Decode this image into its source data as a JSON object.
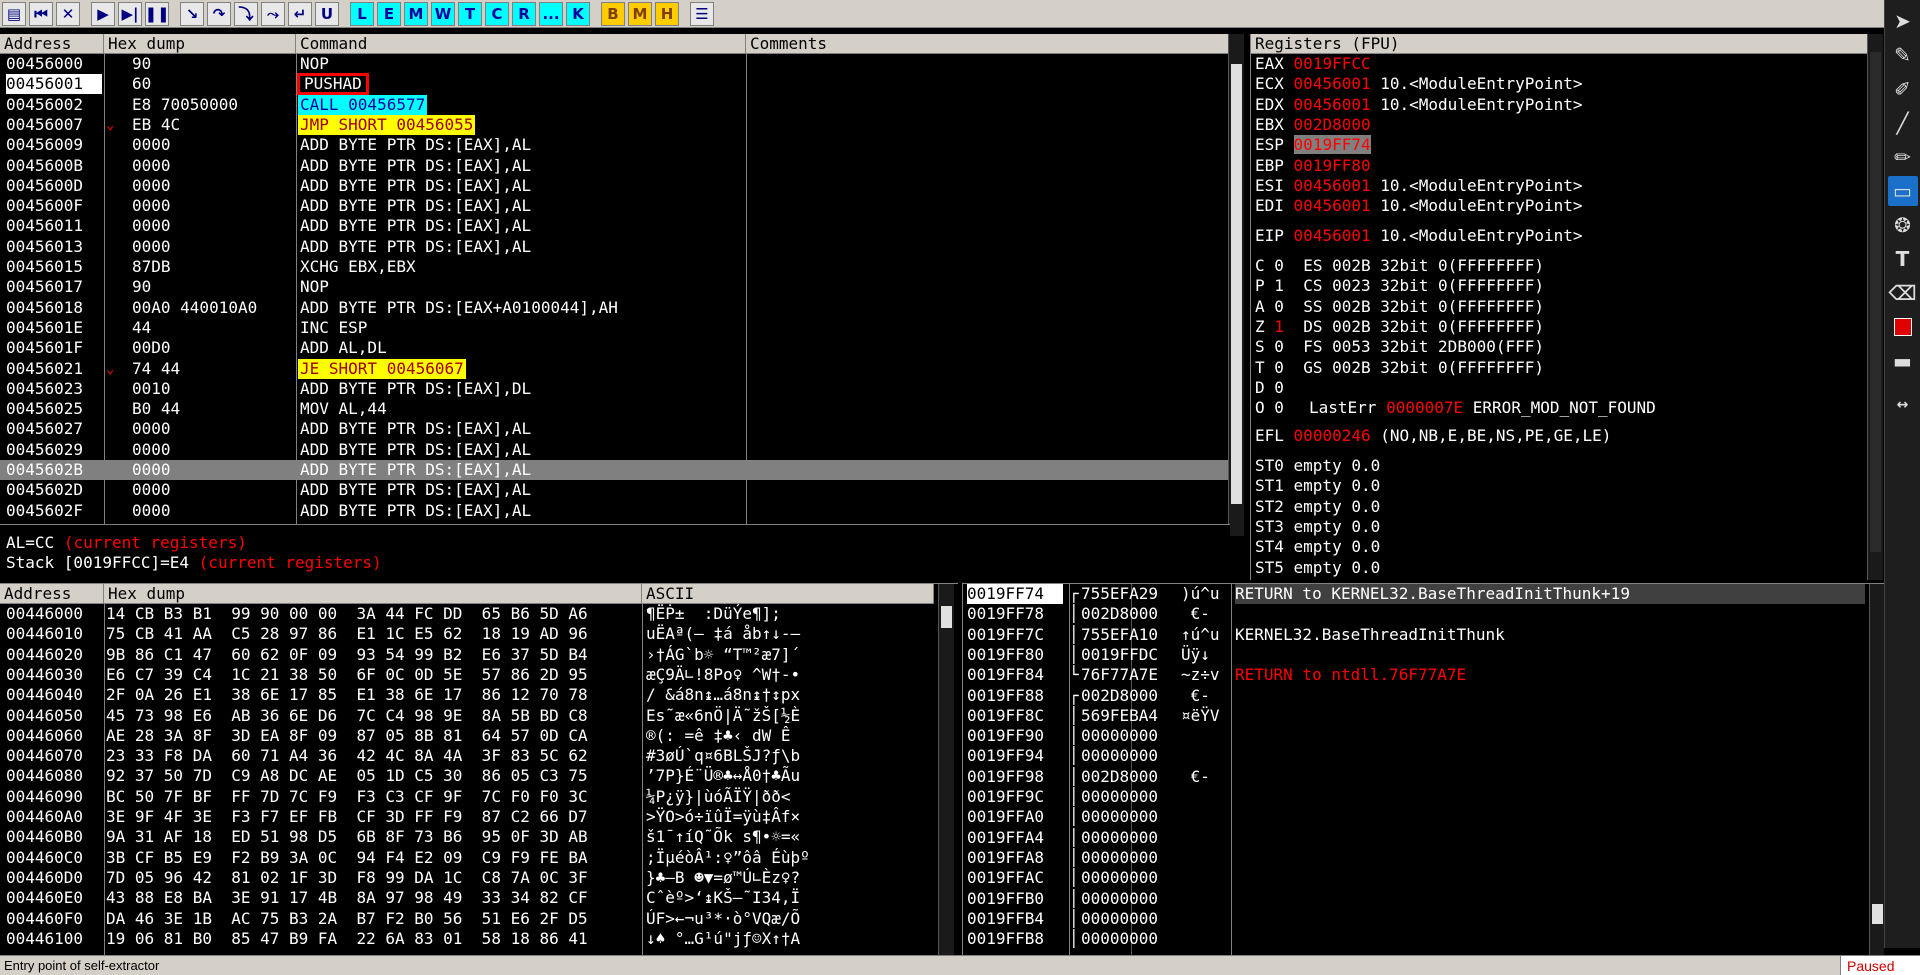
{
  "toolbar": {
    "buttons": [
      "open",
      "rewind",
      "close",
      "run",
      "run-thread",
      "pause",
      "step-into",
      "step-over",
      "trace-into",
      "trace-over",
      "execute-till-return",
      "user-code",
      "L",
      "E",
      "M",
      "W",
      "T",
      "C",
      "R",
      "...",
      "K",
      "B",
      "M",
      "H",
      "list"
    ]
  },
  "disasm": {
    "headers": [
      "Address",
      "Hex dump",
      "Command",
      "Comments"
    ],
    "rows": [
      {
        "addr": "00456000",
        "hex": "90",
        "cmd": "NOP",
        "style": "normal",
        "jump": ""
      },
      {
        "addr": "00456001",
        "hex": "60",
        "cmd": "PUSHAD",
        "style": "eip",
        "jump": ""
      },
      {
        "addr": "00456002",
        "hex": "E8 70050000",
        "cmd": "CALL 00456577",
        "style": "call",
        "jump": ""
      },
      {
        "addr": "00456007",
        "hex": "EB 4C",
        "cmd": "JMP SHORT 00456055",
        "style": "jmp",
        "jump": "⌄"
      },
      {
        "addr": "00456009",
        "hex": "0000",
        "cmd": "ADD BYTE PTR DS:[EAX],AL",
        "style": "normal",
        "jump": ""
      },
      {
        "addr": "0045600B",
        "hex": "0000",
        "cmd": "ADD BYTE PTR DS:[EAX],AL",
        "style": "normal",
        "jump": ""
      },
      {
        "addr": "0045600D",
        "hex": "0000",
        "cmd": "ADD BYTE PTR DS:[EAX],AL",
        "style": "normal",
        "jump": ""
      },
      {
        "addr": "0045600F",
        "hex": "0000",
        "cmd": "ADD BYTE PTR DS:[EAX],AL",
        "style": "normal",
        "jump": ""
      },
      {
        "addr": "00456011",
        "hex": "0000",
        "cmd": "ADD BYTE PTR DS:[EAX],AL",
        "style": "normal",
        "jump": ""
      },
      {
        "addr": "00456013",
        "hex": "0000",
        "cmd": "ADD BYTE PTR DS:[EAX],AL",
        "style": "normal",
        "jump": ""
      },
      {
        "addr": "00456015",
        "hex": "87DB",
        "cmd": "XCHG EBX,EBX",
        "style": "normal",
        "jump": ""
      },
      {
        "addr": "00456017",
        "hex": "90",
        "cmd": "NOP",
        "style": "normal",
        "jump": ""
      },
      {
        "addr": "00456018",
        "hex": "00A0 440010A0",
        "cmd": "ADD BYTE PTR DS:[EAX+A0100044],AH",
        "style": "normal",
        "jump": ""
      },
      {
        "addr": "0045601E",
        "hex": "44",
        "cmd": "INC ESP",
        "style": "normal",
        "jump": ""
      },
      {
        "addr": "0045601F",
        "hex": "00D0",
        "cmd": "ADD AL,DL",
        "style": "normal",
        "jump": ""
      },
      {
        "addr": "00456021",
        "hex": "74 44",
        "cmd": "JE SHORT 00456067",
        "style": "jmp",
        "jump": "⌄"
      },
      {
        "addr": "00456023",
        "hex": "0010",
        "cmd": "ADD BYTE PTR DS:[EAX],DL",
        "style": "normal",
        "jump": ""
      },
      {
        "addr": "00456025",
        "hex": "B0 44",
        "cmd": "MOV AL,44",
        "style": "normal",
        "jump": ""
      },
      {
        "addr": "00456027",
        "hex": "0000",
        "cmd": "ADD BYTE PTR DS:[EAX],AL",
        "style": "normal",
        "jump": ""
      },
      {
        "addr": "00456029",
        "hex": "0000",
        "cmd": "ADD BYTE PTR DS:[EAX],AL",
        "style": "normal",
        "jump": ""
      },
      {
        "addr": "0045602B",
        "hex": "0000",
        "cmd": "ADD BYTE PTR DS:[EAX],AL",
        "style": "selected",
        "jump": ""
      },
      {
        "addr": "0045602D",
        "hex": "0000",
        "cmd": "ADD BYTE PTR DS:[EAX],AL",
        "style": "normal",
        "jump": ""
      },
      {
        "addr": "0045602F",
        "hex": "0000",
        "cmd": "ADD BYTE PTR DS:[EAX],AL",
        "style": "normal",
        "jump": ""
      }
    ],
    "info": [
      {
        "text": "AL=CC",
        "note": "(current registers)"
      },
      {
        "text": "Stack [0019FFCC]=E4",
        "note": "(current registers)"
      }
    ]
  },
  "registers": {
    "title": "Registers (FPU)",
    "gp": [
      {
        "name": "EAX",
        "value": "0019FFCC",
        "desc": ""
      },
      {
        "name": "ECX",
        "value": "00456001",
        "desc": "10.<ModuleEntryPoint>"
      },
      {
        "name": "EDX",
        "value": "00456001",
        "desc": "10.<ModuleEntryPoint>"
      },
      {
        "name": "EBX",
        "value": "002D8000",
        "desc": ""
      },
      {
        "name": "ESP",
        "value": "0019FF74",
        "desc": ""
      },
      {
        "name": "EBP",
        "value": "0019FF80",
        "desc": ""
      },
      {
        "name": "ESI",
        "value": "00456001",
        "desc": "10.<ModuleEntryPoint>"
      },
      {
        "name": "EDI",
        "value": "00456001",
        "desc": "10.<ModuleEntryPoint>"
      }
    ],
    "eip": {
      "name": "EIP",
      "value": "00456001",
      "desc": "10.<ModuleEntryPoint>"
    },
    "flags": [
      {
        "f": "C",
        "v": "0",
        "seg": "ES 002B 32bit 0(FFFFFFFF)"
      },
      {
        "f": "P",
        "v": "1",
        "seg": "CS 0023 32bit 0(FFFFFFFF)"
      },
      {
        "f": "A",
        "v": "0",
        "seg": "SS 002B 32bit 0(FFFFFFFF)"
      },
      {
        "f": "Z",
        "v": "1",
        "seg": "DS 002B 32bit 0(FFFFFFFF)"
      },
      {
        "f": "S",
        "v": "0",
        "seg": "FS 0053 32bit 2DB000(FFF)"
      },
      {
        "f": "T",
        "v": "0",
        "seg": "GS 002B 32bit 0(FFFFFFFF)"
      },
      {
        "f": "D",
        "v": "0",
        "seg": ""
      },
      {
        "f": "O",
        "v": "0",
        "seg": ""
      }
    ],
    "lasterr": {
      "label": "LastErr",
      "value": "0000007E",
      "desc": "ERROR_MOD_NOT_FOUND"
    },
    "efl": {
      "label": "EFL",
      "value": "00000246",
      "desc": "(NO,NB,E,BE,NS,PE,GE,LE)"
    },
    "fpu": [
      "ST0 empty 0.0",
      "ST1 empty 0.0",
      "ST2 empty 0.0",
      "ST3 empty 0.0",
      "ST4 empty 0.0",
      "ST5 empty 0.0"
    ]
  },
  "dump": {
    "headers": [
      "Address",
      "Hex dump",
      "ASCII"
    ],
    "rows": [
      {
        "addr": "00446000",
        "hex": "14 CB B3 B1|99 90 00 00|3A 44 FC DD|65 B6 5D A6",
        "ascii": "¶ËṖ±  :DüÝe¶];"
      },
      {
        "addr": "00446010",
        "hex": "75 CB 41 AA|C5 28 97 86|E1 1C E5 62|18 19 AD 96",
        "ascii": "uËAª(– ‡á åb↑↓-–"
      },
      {
        "addr": "00446020",
        "hex": "9B 86 C1 47|60 62 0F 09|93 54 99 B2|E6 37 5D B4",
        "ascii": "›†ÁG`b☼ “T™²æ7]´"
      },
      {
        "addr": "00446030",
        "hex": "E6 C7 39 C4|1C 21 38 50|6F 0C 0D 5E|57 86 2D 95",
        "ascii": "æÇ9Ä∟!8Po♀ ^W†-•"
      },
      {
        "addr": "00446040",
        "hex": "2F 0A 26 E1|38 6E 17 85|E1 38 6E 17|86 12 70 78",
        "ascii": "/ &á8n↨…á8n↨†↕px"
      },
      {
        "addr": "00446050",
        "hex": "45 73 98 E6|AB 36 6E D6|7C C4 98 9E|8A 5B BD C8",
        "ascii": "Es˜æ«6nÖ|Ä˜žŠ[½È"
      },
      {
        "addr": "00446060",
        "hex": "AE 28 3A 8F|3D EA 8F 09|87 05 8B 81|64 57 0D CA",
        "ascii": "®(: =ê ‡♣‹ dW Ê"
      },
      {
        "addr": "00446070",
        "hex": "23 33 F8 DA|60 71 A4 36|42 4C 8A 4A|3F 83 5C 62",
        "ascii": "#3øÚ`q¤6BLŠJ?ƒ\\b"
      },
      {
        "addr": "00446080",
        "hex": "92 37 50 7D|C9 A8 DC AE|05 1D C5 30|86 05 C3 75",
        "ascii": "’7P}É¨Ü®♣↔Å0†♣Ãu"
      },
      {
        "addr": "00446090",
        "hex": "BC 50 7F BF|FF 7D 7C F9|F3 C3 CF 9F|7C F0 F0 3C",
        "ascii": "¼P¿ÿ}|ùóÃÏŸ|ðð<"
      },
      {
        "addr": "004460A0",
        "hex": "3E 9F 4F 3E|F3 F7 EF FB|CF 3D FF F9|87 C2 66 D7",
        "ascii": ">ŸO>ó÷ïûÏ=ÿù‡Âf×"
      },
      {
        "addr": "004460B0",
        "hex": "9A 31 AF 18|ED 51 98 D5|6B 8F 73 B6|95 0F 3D AB",
        "ascii": "š1¯↑íQ˜Õk s¶•☼=«"
      },
      {
        "addr": "004460C0",
        "hex": "3B CF B5 E9|F2 B9 3A 0C|94 F4 E2 09|C9 F9 FE BA",
        "ascii": ";ÏµéòÂ¹:♀”ôâ Éùþº"
      },
      {
        "addr": "004460D0",
        "hex": "7D 05 96 42|81 02 1F 3D|F8 99 DA 1C|C8 7A 0C 3F",
        "ascii": "}♣–B ☻▼=ø™Ú∟Èz♀?"
      },
      {
        "addr": "004460E0",
        "hex": "43 88 E8 BA|3E 91 17 4B|8A 97 98 49|33 34 82 CF",
        "ascii": "Cˆèº>‘↨KŠ—˜I34‚Ï"
      },
      {
        "addr": "004460F0",
        "hex": "DA 46 3E 1B|AC 75 B3 2A|B7 F2 B0 56|51 E6 2F D5",
        "ascii": "ÚF>←¬u³*·ò°VQæ/Õ"
      },
      {
        "addr": "00446100",
        "hex": "19 06 81 B0|85 47 B9 FA|22 6A 83 01|58 18 86 41",
        "ascii": "↓♠ °…G¹ú\"jƒ☺X↑†A"
      }
    ]
  },
  "stack": {
    "rows": [
      {
        "addr": "0019FF74",
        "val": "755EFA29",
        "asc": ")ú^u",
        "cmt": "RETURN to KERNEL32.BaseThreadInitThunk+19",
        "cstyle": "white",
        "bracket": "┌"
      },
      {
        "addr": "0019FF78",
        "val": "002D8000",
        "asc": " €-",
        "cmt": "",
        "cstyle": "white",
        "bracket": "│"
      },
      {
        "addr": "0019FF7C",
        "val": "755EFA10",
        "asc": "↑ú^u",
        "cmt": "KERNEL32.BaseThreadInitThunk",
        "cstyle": "white",
        "bracket": "│"
      },
      {
        "addr": "0019FF80",
        "val": "0019FFDC",
        "asc": "Üÿ↓",
        "cmt": "",
        "cstyle": "white",
        "bracket": "│"
      },
      {
        "addr": "0019FF84",
        "val": "76F77A7E",
        "asc": "~z÷v",
        "cmt": "RETURN to ntdll.76F77A7E",
        "cstyle": "red",
        "bracket": "└"
      },
      {
        "addr": "0019FF88",
        "val": "002D8000",
        "asc": " €-",
        "cmt": "",
        "cstyle": "white",
        "bracket": "┌"
      },
      {
        "addr": "0019FF8C",
        "val": "569FEBA4",
        "asc": "¤ëŸV",
        "cmt": "",
        "cstyle": "white",
        "bracket": "│"
      },
      {
        "addr": "0019FF90",
        "val": "00000000",
        "asc": "",
        "cmt": "",
        "cstyle": "white",
        "bracket": "│"
      },
      {
        "addr": "0019FF94",
        "val": "00000000",
        "asc": "",
        "cmt": "",
        "cstyle": "white",
        "bracket": "│"
      },
      {
        "addr": "0019FF98",
        "val": "002D8000",
        "asc": " €-",
        "cmt": "",
        "cstyle": "white",
        "bracket": "│"
      },
      {
        "addr": "0019FF9C",
        "val": "00000000",
        "asc": "",
        "cmt": "",
        "cstyle": "white",
        "bracket": "│"
      },
      {
        "addr": "0019FFA0",
        "val": "00000000",
        "asc": "",
        "cmt": "",
        "cstyle": "white",
        "bracket": "│"
      },
      {
        "addr": "0019FFA4",
        "val": "00000000",
        "asc": "",
        "cmt": "",
        "cstyle": "white",
        "bracket": "│"
      },
      {
        "addr": "0019FFA8",
        "val": "00000000",
        "asc": "",
        "cmt": "",
        "cstyle": "white",
        "bracket": "│"
      },
      {
        "addr": "0019FFAC",
        "val": "00000000",
        "asc": "",
        "cmt": "",
        "cstyle": "white",
        "bracket": "│"
      },
      {
        "addr": "0019FFB0",
        "val": "00000000",
        "asc": "",
        "cmt": "",
        "cstyle": "white",
        "bracket": "│"
      },
      {
        "addr": "0019FFB4",
        "val": "00000000",
        "asc": "",
        "cmt": "",
        "cstyle": "white",
        "bracket": "│"
      },
      {
        "addr": "0019FFB8",
        "val": "00000000",
        "asc": "",
        "cmt": "",
        "cstyle": "white",
        "bracket": "│"
      }
    ]
  },
  "status": {
    "text": "Entry point of self-extractor",
    "state": "Paused"
  },
  "colors": {
    "call_bg": "#00ffff",
    "jmp_bg": "#ffff00",
    "selected_bg": "#808080",
    "eip_outline": "#ff0000",
    "reg_changed": "#ff0000",
    "header_bg": "#d4d0c8"
  }
}
